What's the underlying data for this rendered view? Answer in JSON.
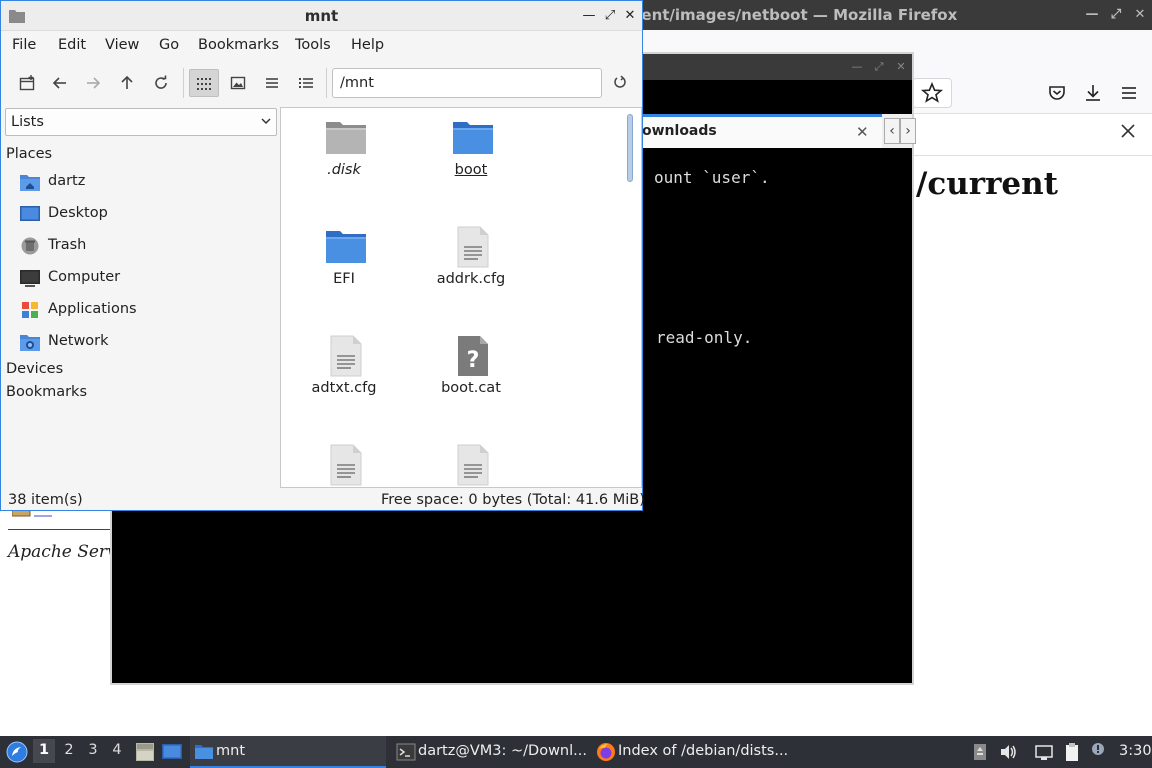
{
  "firefox": {
    "title": "rent/images/netboot — Mozilla Firefox",
    "heading_fragment": "/current",
    "footer_fragment": "Apache Serv"
  },
  "terminal": {
    "tab_label": "ownloads",
    "lines": [
      "ount `user`.",
      "read-only."
    ]
  },
  "file_manager": {
    "title": "mnt",
    "menu": [
      "File",
      "Edit",
      "View",
      "Go",
      "Bookmarks",
      "Tools",
      "Help"
    ],
    "location": "/mnt",
    "sidebar_mode": "Lists",
    "sections": {
      "places": "Places",
      "devices": "Devices",
      "bookmarks": "Bookmarks"
    },
    "places": [
      {
        "label": "dartz",
        "icon": "home-folder-icon"
      },
      {
        "label": "Desktop",
        "icon": "desktop-icon"
      },
      {
        "label": "Trash",
        "icon": "trash-icon"
      },
      {
        "label": "Computer",
        "icon": "computer-icon"
      },
      {
        "label": "Applications",
        "icon": "applications-icon"
      },
      {
        "label": "Network",
        "icon": "network-icon"
      }
    ],
    "files": [
      {
        "name": ".disk",
        "icon": "folder-gray-icon"
      },
      {
        "name": "boot",
        "icon": "folder-blue-icon"
      },
      {
        "name": "EFI",
        "icon": "folder-blue-icon"
      },
      {
        "name": "addrk.cfg",
        "icon": "text-file-icon"
      },
      {
        "name": "adtxt.cfg",
        "icon": "text-file-icon"
      },
      {
        "name": "boot.cat",
        "icon": "unknown-file-icon"
      },
      {
        "name": "",
        "icon": "text-file-icon"
      },
      {
        "name": "",
        "icon": "text-file-icon"
      }
    ],
    "status": {
      "item_count": "38 item(s)",
      "free_space": "Free space: 0 bytes (Total: 41.6 MiB)"
    }
  },
  "taskbar": {
    "workspaces": [
      "1",
      "2",
      "3",
      "4"
    ],
    "tasks": [
      {
        "label": "mnt",
        "icon": "folder-icon"
      },
      {
        "label": "dartz@VM3: ~/Downl...",
        "icon": "terminal-icon"
      },
      {
        "label": "Index of /debian/dists...",
        "icon": "firefox-icon"
      }
    ],
    "clock": "3:30"
  }
}
